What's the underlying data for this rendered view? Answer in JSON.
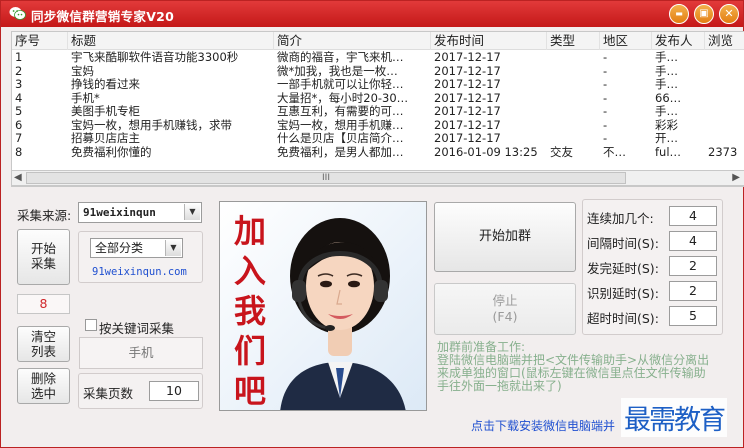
{
  "window": {
    "title": "同步微信群营销专家V20",
    "min_glyph": "▬",
    "max_glyph": "▣",
    "close_glyph": "✕"
  },
  "table": {
    "columns": [
      "序号",
      "标题",
      "简介",
      "发布时间",
      "类型",
      "地区",
      "发布人",
      "浏览"
    ],
    "rows": [
      [
        "1",
        "宇飞来酷聊软件语音功能3300秒",
        "微商的福音，宇飞来机…",
        "2017-12-17",
        "",
        "-",
        "手…",
        ""
      ],
      [
        "2",
        "宝妈",
        "微*加我，我也是一枚…",
        "2017-12-17",
        "",
        "-",
        "手…",
        ""
      ],
      [
        "3",
        "挣钱的看过来",
        "一部手机就可以让你轻…",
        "2017-12-17",
        "",
        "-",
        "手…",
        ""
      ],
      [
        "4",
        "手机*",
        "大量招*，每小时20-30…",
        "2017-12-17",
        "",
        "-",
        "66…",
        ""
      ],
      [
        "5",
        "美图手机专柜",
        "互惠互利，有需要的可…",
        "2017-12-17",
        "",
        "-",
        "手…",
        ""
      ],
      [
        "6",
        "宝妈一枚，想用手机赚钱，求带",
        "宝妈一枚，想用手机赚…",
        "2017-12-17",
        "",
        "-",
        "彩彩",
        ""
      ],
      [
        "7",
        "招募贝店店主",
        "什么是贝店【贝店简介…",
        "2017-12-17",
        "",
        "-",
        "开…",
        ""
      ],
      [
        "8",
        "免费福利你懂的",
        "免费福利，是男人都加…",
        "2016-01-09 13:25",
        "交友",
        "不…",
        "ful…",
        "2373"
      ]
    ],
    "scroll_glyph": "III",
    "scroll_left": "◀",
    "scroll_right": "▶"
  },
  "collect": {
    "source_label": "采集来源:",
    "source_value": "91weixinqun",
    "category_value": "全部分类",
    "site_link": "91weixinqun.com",
    "start_button": "开始\n采集",
    "count_value": "8",
    "clear_button": "清空\n列表",
    "delete_button": "删除\n选中",
    "keyword_checkbox_label": "按关键词采集",
    "keyword_placeholder": "手机",
    "pages_label": "采集页数",
    "pages_value": "10"
  },
  "banner": {
    "chars": [
      "加",
      "入",
      "我",
      "们",
      "吧"
    ]
  },
  "group_add": {
    "start_button": "开始加群",
    "stop_button": "停止\n(F4)",
    "settings": [
      {
        "label": "连续加几个:",
        "value": "4"
      },
      {
        "label": "间隔时间(S):",
        "value": "4"
      },
      {
        "label": "发完延时(S):",
        "value": "2"
      },
      {
        "label": "识别延时(S):",
        "value": "2"
      },
      {
        "label": "超时时间(S):",
        "value": "5"
      }
    ],
    "note_title": "加群前准备工作:",
    "note_body": "登陆微信电脑端并把<文件传输助手>从微信分离出来成单独的窗口(鼠标左键在微信里点住文件传输助手往外面一拖就出来了)",
    "download_link": "点击下载安装微信电脑端并"
  },
  "watermark": "最需教育",
  "colors": {
    "title_bar": "#d42a2a",
    "window_bg": "#f2eeee",
    "note": "#87b08d",
    "link": "#2050d0",
    "banner_text": "#c8141c"
  }
}
